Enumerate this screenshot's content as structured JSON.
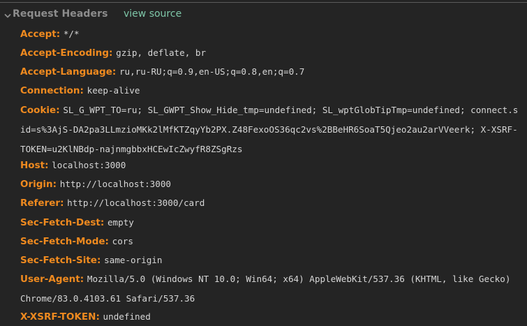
{
  "section": {
    "title": "Request Headers",
    "view_source_label": "view source"
  },
  "headers": [
    {
      "name": "Accept",
      "value": "*/*"
    },
    {
      "name": "Accept-Encoding",
      "value": "gzip, deflate, br"
    },
    {
      "name": "Accept-Language",
      "value": "ru,ru-RU;q=0.9,en-US;q=0.8,en;q=0.7"
    },
    {
      "name": "Connection",
      "value": "keep-alive"
    },
    {
      "name": "Cookie",
      "value": "SL_G_WPT_TO=ru; SL_GWPT_Show_Hide_tmp=undefined; SL_wptGlobTipTmp=undefined; connect.sid=s%3AjS-DA2pa3LLmzioMKk2lMfKTZqyYb2PX.Z48FexoOS36qc2vs%2BBeHR6SoaT5Qjeo2au2arVVeerk; X-XSRF-TOKEN=u2KlNBdp-najnmgbbxHCEwIcZwyfR8ZSgRzs"
    },
    {
      "name": "Host",
      "value": "localhost:3000"
    },
    {
      "name": "Origin",
      "value": "http://localhost:3000"
    },
    {
      "name": "Referer",
      "value": "http://localhost:3000/card"
    },
    {
      "name": "Sec-Fetch-Dest",
      "value": "empty"
    },
    {
      "name": "Sec-Fetch-Mode",
      "value": "cors"
    },
    {
      "name": "Sec-Fetch-Site",
      "value": "same-origin"
    },
    {
      "name": "User-Agent",
      "value": "Mozilla/5.0 (Windows NT 10.0; Win64; x64) AppleWebKit/537.36 (KHTML, like Gecko) Chrome/83.0.4103.61 Safari/537.36"
    },
    {
      "name": "X-XSRF-TOKEN",
      "value": "undefined"
    }
  ],
  "icons": {
    "collapse": "chevron-down-icon"
  },
  "colors": {
    "background": "#242424",
    "header_name": "#ef8a1f",
    "header_value": "#d6d6d6",
    "section_title": "#8d8d8d",
    "link": "#7ec7a8"
  }
}
